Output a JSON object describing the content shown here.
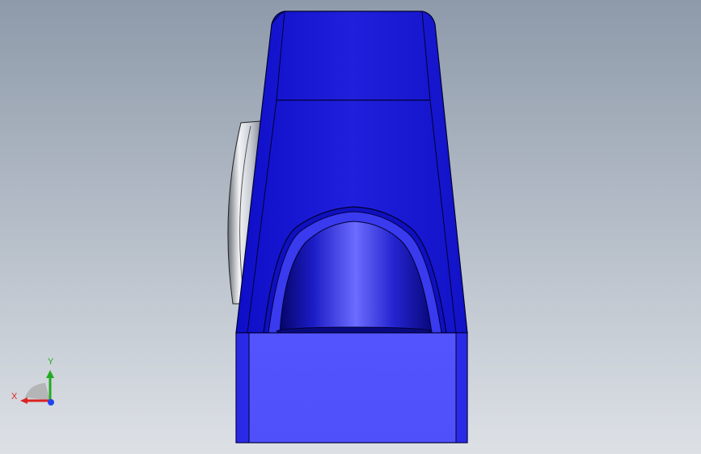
{
  "view": {
    "background_top": "#8e9aaa",
    "background_bottom": "#dde1e6"
  },
  "model": {
    "body_color": "#2222dd",
    "base_color": "#5555ff",
    "edge_color": "#000033",
    "bearing_color": "#c8ccd4"
  },
  "triad": {
    "x_label": "X",
    "y_label": "Y",
    "x_color": "#dd2222",
    "y_color": "#22aa22",
    "z_color": "#2244ee"
  }
}
